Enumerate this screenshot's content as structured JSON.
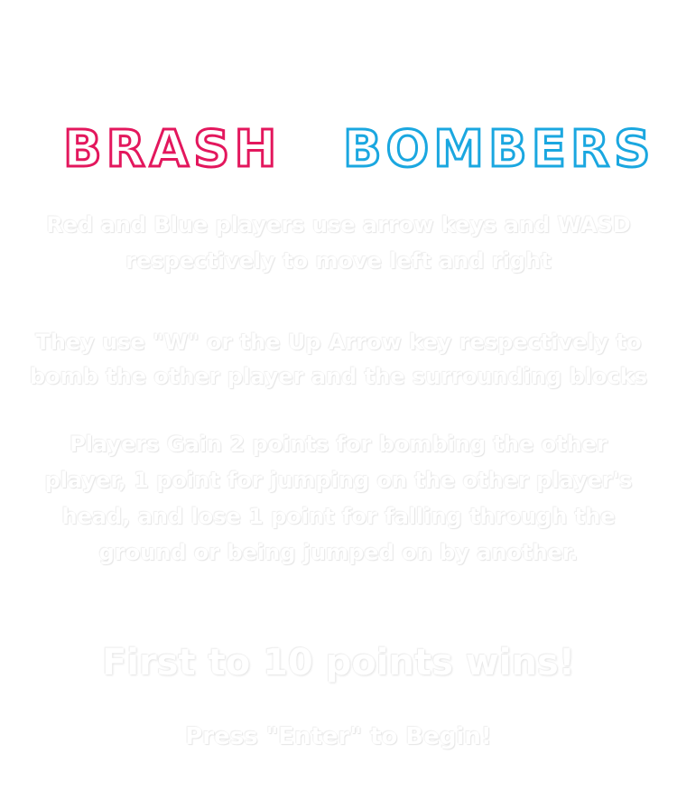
{
  "title": {
    "word1": "BRASH",
    "word2": "BOMBERS",
    "word1_color": "#e3175d",
    "word2_color": "#1aa7e0"
  },
  "instructions": {
    "movement": "Red and Blue players use arrow keys and WASD respectively to move left and right",
    "bombing": "They use \"W\" or the Up Arrow key respectively to bomb the other player and the surrounding blocks",
    "scoring": "Players Gain 2 points for bombing the other player, 1 point for jumping on the other player's head, and lose 1 point for falling through the ground or being jumped on by another."
  },
  "goal": "First to 10 points wins!",
  "start_prompt": "Press \"Enter\" to Begin!",
  "colors": {
    "background": "#ffffff",
    "text": "#ffffff"
  }
}
